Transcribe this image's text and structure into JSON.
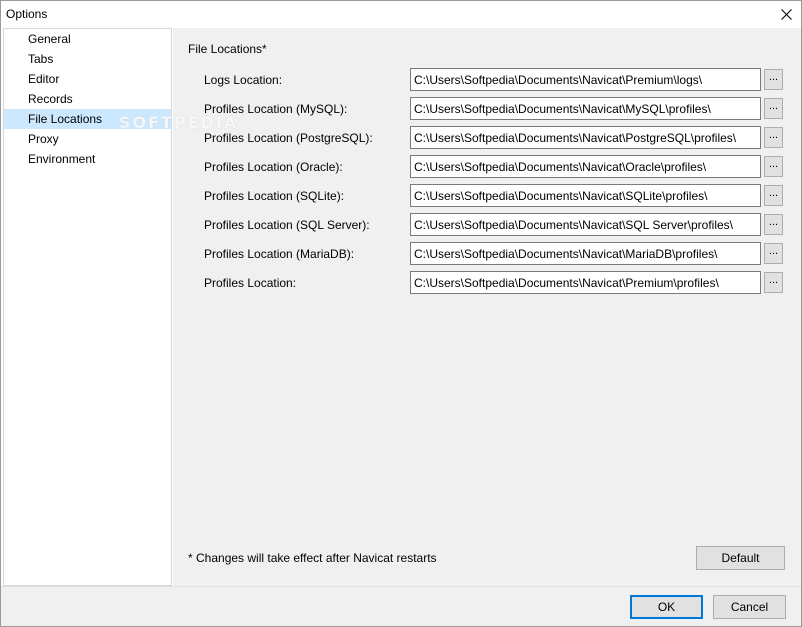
{
  "window": {
    "title": "Options",
    "close_icon": "close-icon"
  },
  "sidebar": {
    "items": [
      {
        "label": "General",
        "selected": false
      },
      {
        "label": "Tabs",
        "selected": false
      },
      {
        "label": "Editor",
        "selected": false
      },
      {
        "label": "Records",
        "selected": false
      },
      {
        "label": "File Locations",
        "selected": true
      },
      {
        "label": "Proxy",
        "selected": false
      },
      {
        "label": "Environment",
        "selected": false
      }
    ]
  },
  "main": {
    "section_title": "File Locations*",
    "browse_label": "...",
    "rows": [
      {
        "label": "Logs Location:",
        "value": "C:\\Users\\Softpedia\\Documents\\Navicat\\Premium\\logs\\"
      },
      {
        "label": "Profiles Location (MySQL):",
        "value": "C:\\Users\\Softpedia\\Documents\\Navicat\\MySQL\\profiles\\"
      },
      {
        "label": "Profiles Location (PostgreSQL):",
        "value": "C:\\Users\\Softpedia\\Documents\\Navicat\\PostgreSQL\\profiles\\"
      },
      {
        "label": "Profiles Location (Oracle):",
        "value": "C:\\Users\\Softpedia\\Documents\\Navicat\\Oracle\\profiles\\"
      },
      {
        "label": "Profiles Location (SQLite):",
        "value": "C:\\Users\\Softpedia\\Documents\\Navicat\\SQLite\\profiles\\"
      },
      {
        "label": "Profiles Location (SQL Server):",
        "value": "C:\\Users\\Softpedia\\Documents\\Navicat\\SQL Server\\profiles\\"
      },
      {
        "label": "Profiles Location (MariaDB):",
        "value": "C:\\Users\\Softpedia\\Documents\\Navicat\\MariaDB\\profiles\\"
      },
      {
        "label": "Profiles Location:",
        "value": "C:\\Users\\Softpedia\\Documents\\Navicat\\Premium\\profiles\\"
      }
    ],
    "note": "* Changes will take effect after Navicat restarts",
    "default_label": "Default"
  },
  "footer": {
    "ok_label": "OK",
    "cancel_label": "Cancel"
  },
  "watermark": "SOFTPEDIA",
  "colors": {
    "selected_bg": "#cce8ff",
    "panel_bg": "#f0f0f0",
    "accent_border": "#0078d7"
  }
}
